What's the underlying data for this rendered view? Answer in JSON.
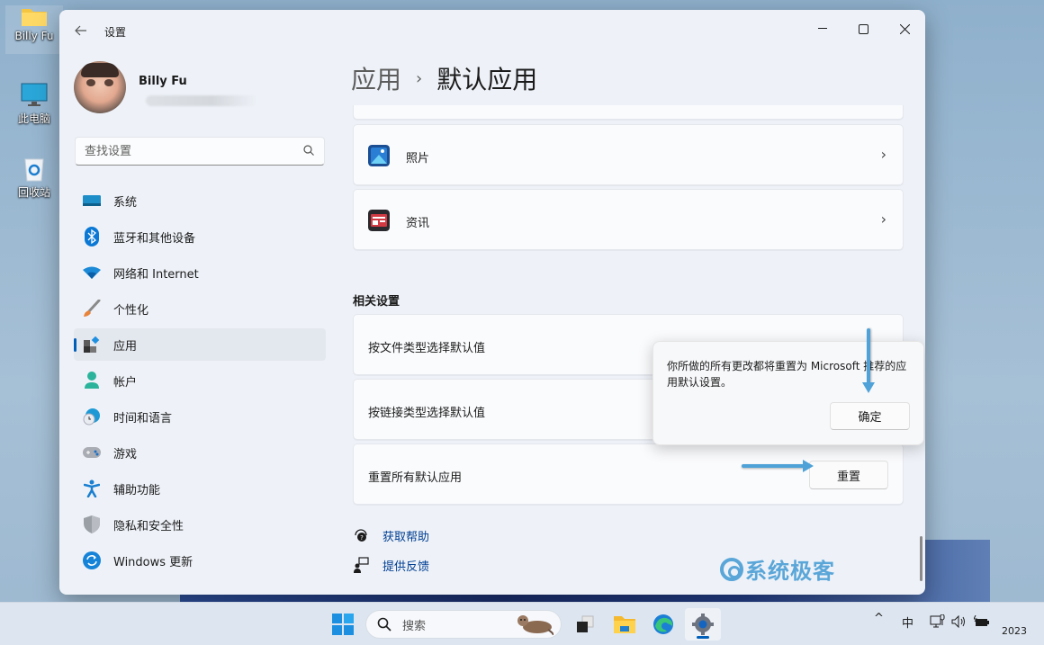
{
  "desktop": {
    "icons": [
      {
        "label": "Billy Fu",
        "icon": "folder-icon"
      },
      {
        "label": "此电脑",
        "icon": "computer-icon"
      },
      {
        "label": "回收站",
        "icon": "recycle-bin-icon"
      }
    ]
  },
  "window": {
    "title": "设置",
    "controls": {
      "minimize": "—",
      "maximize": "☐",
      "close": "✕"
    }
  },
  "profile": {
    "name": "Billy Fu"
  },
  "search": {
    "placeholder": "查找设置",
    "value": ""
  },
  "sidebar": {
    "items": [
      {
        "label": "系统",
        "icon": "system-icon",
        "active": false
      },
      {
        "label": "蓝牙和其他设备",
        "icon": "bluetooth-icon",
        "active": false
      },
      {
        "label": "网络和 Internet",
        "icon": "wifi-icon",
        "active": false
      },
      {
        "label": "个性化",
        "icon": "brush-icon",
        "active": false
      },
      {
        "label": "应用",
        "icon": "apps-icon",
        "active": true
      },
      {
        "label": "帐户",
        "icon": "account-icon",
        "active": false
      },
      {
        "label": "时间和语言",
        "icon": "time-language-icon",
        "active": false
      },
      {
        "label": "游戏",
        "icon": "gamepad-icon",
        "active": false
      },
      {
        "label": "辅助功能",
        "icon": "accessibility-icon",
        "active": false
      },
      {
        "label": "隐私和安全性",
        "icon": "shield-icon",
        "active": false
      },
      {
        "label": "Windows 更新",
        "icon": "update-icon",
        "active": false
      }
    ]
  },
  "breadcrumb": {
    "parent": "应用",
    "separator": "›",
    "current": "默认应用"
  },
  "apps": [
    {
      "label": "照片",
      "icon": "photos-icon"
    },
    {
      "label": "资讯",
      "icon": "news-icon"
    }
  ],
  "related": {
    "title": "相关设置",
    "rows": [
      {
        "label": "按文件类型选择默认值"
      },
      {
        "label": "按链接类型选择默认值"
      },
      {
        "label": "重置所有默认应用",
        "button": "重置"
      }
    ]
  },
  "flyout": {
    "message": "你所做的所有更改都将重置为 Microsoft 推荐的应用默认设置。",
    "confirm": "确定"
  },
  "links": [
    {
      "label": "获取帮助",
      "icon": "help-icon"
    },
    {
      "label": "提供反馈",
      "icon": "feedback-icon"
    }
  ],
  "watermark": "系统极客",
  "taskbar": {
    "search_label": "搜索",
    "apps": [
      "start-icon",
      "task-view-icon",
      "file-explorer-icon",
      "edge-icon",
      "settings-icon"
    ],
    "tray": {
      "chevron": "^",
      "ime": "中",
      "clock": "2023"
    }
  },
  "colors": {
    "accent": "#005fb8",
    "link": "#003e92",
    "annotation": "#4ea2d8"
  }
}
